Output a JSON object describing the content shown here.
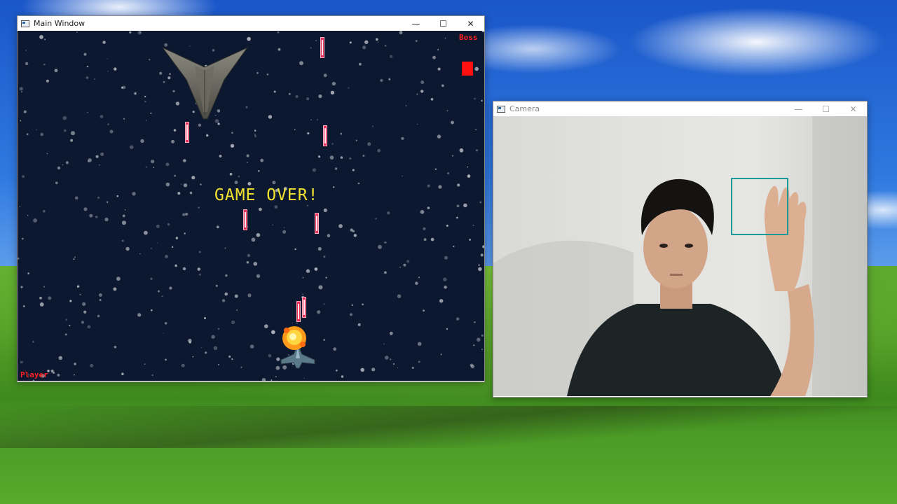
{
  "main_window": {
    "title": "Main Window",
    "controls": {
      "minimize": "—",
      "maximize": "☐",
      "close": "✕"
    },
    "game": {
      "boss_label": "Boss",
      "player_label": "Player",
      "message": "GAME OVER!"
    }
  },
  "camera_window": {
    "title": "Camera",
    "controls": {
      "minimize": "—",
      "maximize": "☐",
      "close": "✕"
    }
  },
  "colors": {
    "game_background": "#0c1830",
    "bullet": "#e8305a",
    "hud_label": "#ff2020",
    "game_over_text": "#f2e230",
    "detection_box": "#1a9a9a"
  },
  "icons": [
    "window-app-icon",
    "minimize-icon",
    "maximize-icon",
    "close-icon",
    "boss-ship-icon",
    "player-ship-icon",
    "explosion-icon"
  ]
}
